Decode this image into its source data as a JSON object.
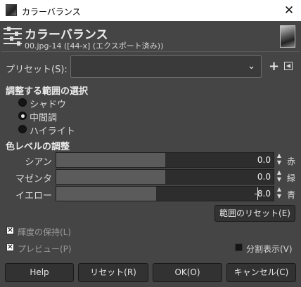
{
  "window": {
    "title": "カラーバランス",
    "close_glyph": "✕"
  },
  "header": {
    "title": "カラーバランス",
    "subtitle": "00.jpg-14 ([44-x] (エクスポート済み))"
  },
  "presets": {
    "label": "プリセット(S):",
    "value": "",
    "arrow": "⌄",
    "add": "+"
  },
  "range_section": {
    "title": "調整する範囲の選択",
    "options": [
      {
        "label": "シャドウ",
        "selected": false
      },
      {
        "label": "中間調",
        "selected": true
      },
      {
        "label": "ハイライト",
        "selected": false
      }
    ]
  },
  "color_section": {
    "title": "色レベルの調整",
    "rows": [
      {
        "left": "シアン",
        "right": "赤",
        "value": "0.0",
        "level": 0.0
      },
      {
        "left": "マゼンタ",
        "right": "緑",
        "value": "0.0",
        "level": 0.0
      },
      {
        "left": "イエロー",
        "right": "青",
        "value": "-8.0",
        "level": -8.0
      }
    ],
    "reset_range_label": "範囲のリセット(E)"
  },
  "options": {
    "preserve_luminosity": {
      "label": "輝度の保持(L)",
      "checked": true
    },
    "preview": {
      "label": "プレビュー(P)",
      "checked": true
    },
    "split_view": {
      "label": "分割表示(V)",
      "checked": false
    }
  },
  "buttons": {
    "help": "Help",
    "reset": "リセット(R)",
    "ok": "OK(O)",
    "cancel": "キャンセル(C)"
  },
  "icons": {
    "spin_up": "▲",
    "spin_down": "▼",
    "check": "✕"
  }
}
